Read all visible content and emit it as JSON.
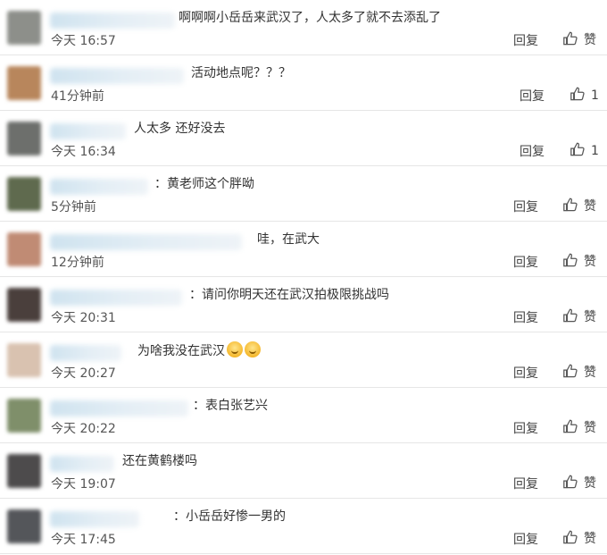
{
  "comments": [
    {
      "text": "啊啊啊小岳岳来武汉了，人太多了就不去添乱了",
      "time": "今天 16:57",
      "reply": "回复",
      "like": "赞",
      "avatar_color": "#8d8f8a"
    },
    {
      "text": "活动地点呢？？？",
      "time": "41分钟前",
      "reply": "回复",
      "like": "1",
      "avatar_color": "#b8865c"
    },
    {
      "text": "人太多  还好没去",
      "time": "今天 16:34",
      "reply": "回复",
      "like": "1",
      "avatar_color": "#6d6f6c"
    },
    {
      "text": "：黄老师这个胖呦",
      "time": "5分钟前",
      "reply": "回复",
      "like": "赞",
      "avatar_color": "#5f6a4e"
    },
    {
      "text": "哇，在武大",
      "time": "12分钟前",
      "reply": "回复",
      "like": "赞",
      "avatar_color": "#c08b74"
    },
    {
      "text": "：请问你明天还在武汉拍极限挑战吗",
      "time": "今天 20:31",
      "reply": "回复",
      "like": "赞",
      "avatar_color": "#4a3f3c"
    },
    {
      "text": "为啥我没在武汉",
      "time": "今天 20:27",
      "reply": "回复",
      "like": "赞",
      "avatar_color": "#d9c2b0"
    },
    {
      "text": "：表白张艺兴",
      "time": "今天 20:22",
      "reply": "回复",
      "like": "赞",
      "avatar_color": "#7f8f6a"
    },
    {
      "text": "还在黄鹤楼吗",
      "time": "今天 19:07",
      "reply": "回复",
      "like": "赞",
      "avatar_color": "#4d4b4c"
    },
    {
      "text": "：小岳岳好惨一男的",
      "time": "今天 17:45",
      "reply": "回复",
      "like": "赞",
      "avatar_color": "#54565a"
    }
  ]
}
